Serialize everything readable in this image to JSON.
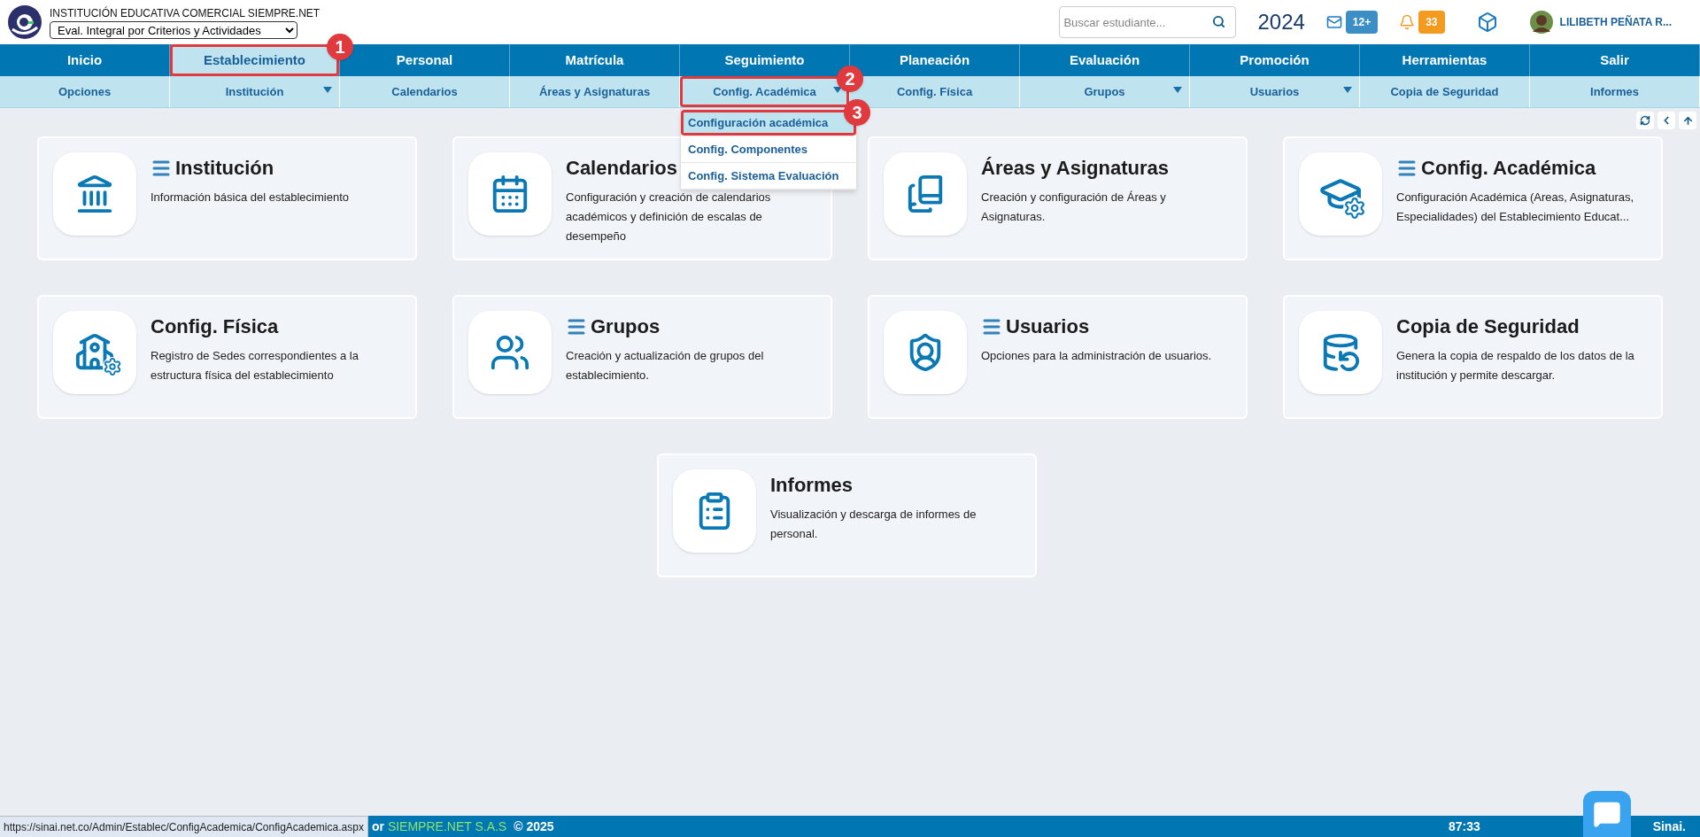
{
  "header": {
    "institution": "INSTITUCIÓN EDUCATIVA COMERCIAL SIEMPRE.NET",
    "evaluation_select": "Eval. Integral por Criterios y Actividades",
    "search": {
      "placeholder": "Buscar estudiante..."
    },
    "year": "2024",
    "messages_badge": "12+",
    "notifications_badge": "33",
    "user_name": "LILIBETH PEÑATA R..."
  },
  "main_nav": [
    {
      "label": "Inicio",
      "selected": false
    },
    {
      "label": "Establecimiento",
      "selected": true,
      "annotation": "1"
    },
    {
      "label": "Personal",
      "selected": false
    },
    {
      "label": "Matrícula",
      "selected": false
    },
    {
      "label": "Seguimiento",
      "selected": false
    },
    {
      "label": "Planeación",
      "selected": false
    },
    {
      "label": "Evaluación",
      "selected": false
    },
    {
      "label": "Promoción",
      "selected": false
    },
    {
      "label": "Herramientas",
      "selected": false
    },
    {
      "label": "Salir",
      "selected": false
    }
  ],
  "sub_nav": [
    {
      "label": "Opciones",
      "has_menu": false
    },
    {
      "label": "Institución",
      "has_menu": true
    },
    {
      "label": "Calendarios",
      "has_menu": false
    },
    {
      "label": "Áreas y Asignaturas",
      "has_menu": false
    },
    {
      "label": "Config. Académica",
      "has_menu": true,
      "annotation": "2",
      "dropdown": [
        {
          "label": "Configuración académica",
          "selected": true,
          "annotation": "3"
        },
        {
          "label": "Config. Componentes",
          "selected": false
        },
        {
          "label": "Config. Sistema Evaluación",
          "selected": false
        }
      ]
    },
    {
      "label": "Config. Física",
      "has_menu": false
    },
    {
      "label": "Grupos",
      "has_menu": true
    },
    {
      "label": "Usuarios",
      "has_menu": true
    },
    {
      "label": "Copia de Seguridad",
      "has_menu": false
    },
    {
      "label": "Informes",
      "has_menu": false
    }
  ],
  "cards": [
    {
      "title": "Institución",
      "menu": true,
      "description": "Información básica del establecimiento"
    },
    {
      "title": "Calendarios",
      "menu": false,
      "description": "Configuración y creación de calendarios académicos y definición de escalas de desempeño"
    },
    {
      "title": "Áreas y Asignaturas",
      "menu": false,
      "description": "Creación y configuración de Áreas y Asignaturas."
    },
    {
      "title": "Config. Académica",
      "menu": true,
      "description": "Configuración Académica (Areas, Asignaturas, Especialidades) del Establecimiento Educat..."
    },
    {
      "title": "Config. Física",
      "menu": false,
      "description": "Registro de Sedes correspondientes a la estructura física del establecimiento"
    },
    {
      "title": "Grupos",
      "menu": true,
      "description": "Creación y actualización de grupos del establecimiento."
    },
    {
      "title": "Usuarios",
      "menu": true,
      "description": "Opciones para la administración de usuarios."
    },
    {
      "title": "Copia de Seguridad",
      "menu": false,
      "description": "Genera la copia de respaldo de los datos de la institución y permite descargar."
    },
    {
      "title": "Informes",
      "menu": false,
      "description": "Visualización y descarga de informes de personal."
    }
  ],
  "footer": {
    "status_url": "https://sinai.net.co/Admin/Establec/ConfigAcademica/ConfigAcademica.aspx",
    "credit_prefix": "or",
    "company": "SIEMPRE.NET S.A.S",
    "copyright": "© 2025",
    "timer": "87:33",
    "brand": "Sinai."
  }
}
